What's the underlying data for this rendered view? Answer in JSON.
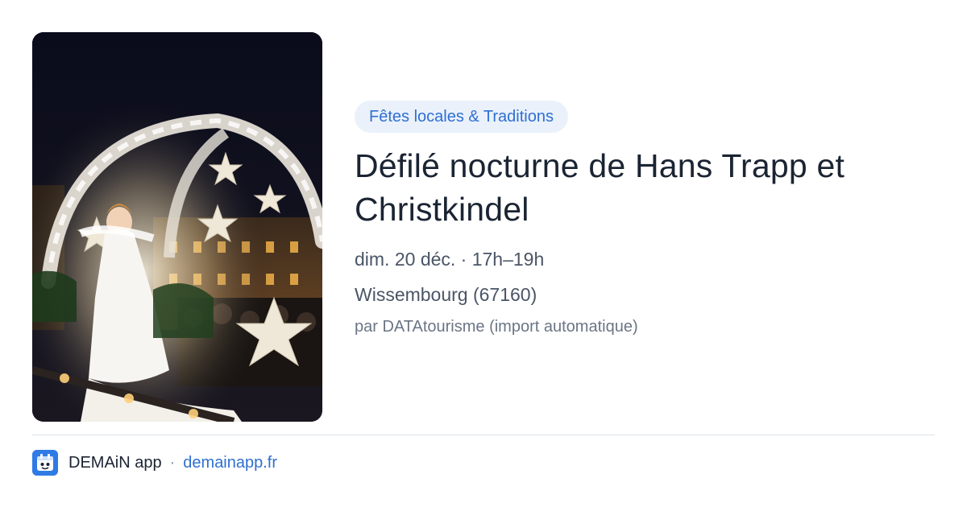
{
  "event": {
    "category": "Fêtes locales & Traditions",
    "title": "Défilé nocturne de Hans Trapp et Christkindel",
    "datetime": "dim. 20 déc. · 17h–19h",
    "location": "Wissembourg (67160)",
    "source": "par DATAtourisme (import automatique)",
    "photo_subject": "night-parade-photo"
  },
  "footer": {
    "app_name": "DEMAiN app",
    "separator": "·",
    "domain": "demainapp.fr",
    "logo_icon": "demain-logo-icon"
  },
  "colors": {
    "accent": "#2f6fd1",
    "pill_bg": "#eaf1fb",
    "logo_bg": "#2f7be6",
    "title": "#1b2433",
    "muted": "#4a5566"
  }
}
